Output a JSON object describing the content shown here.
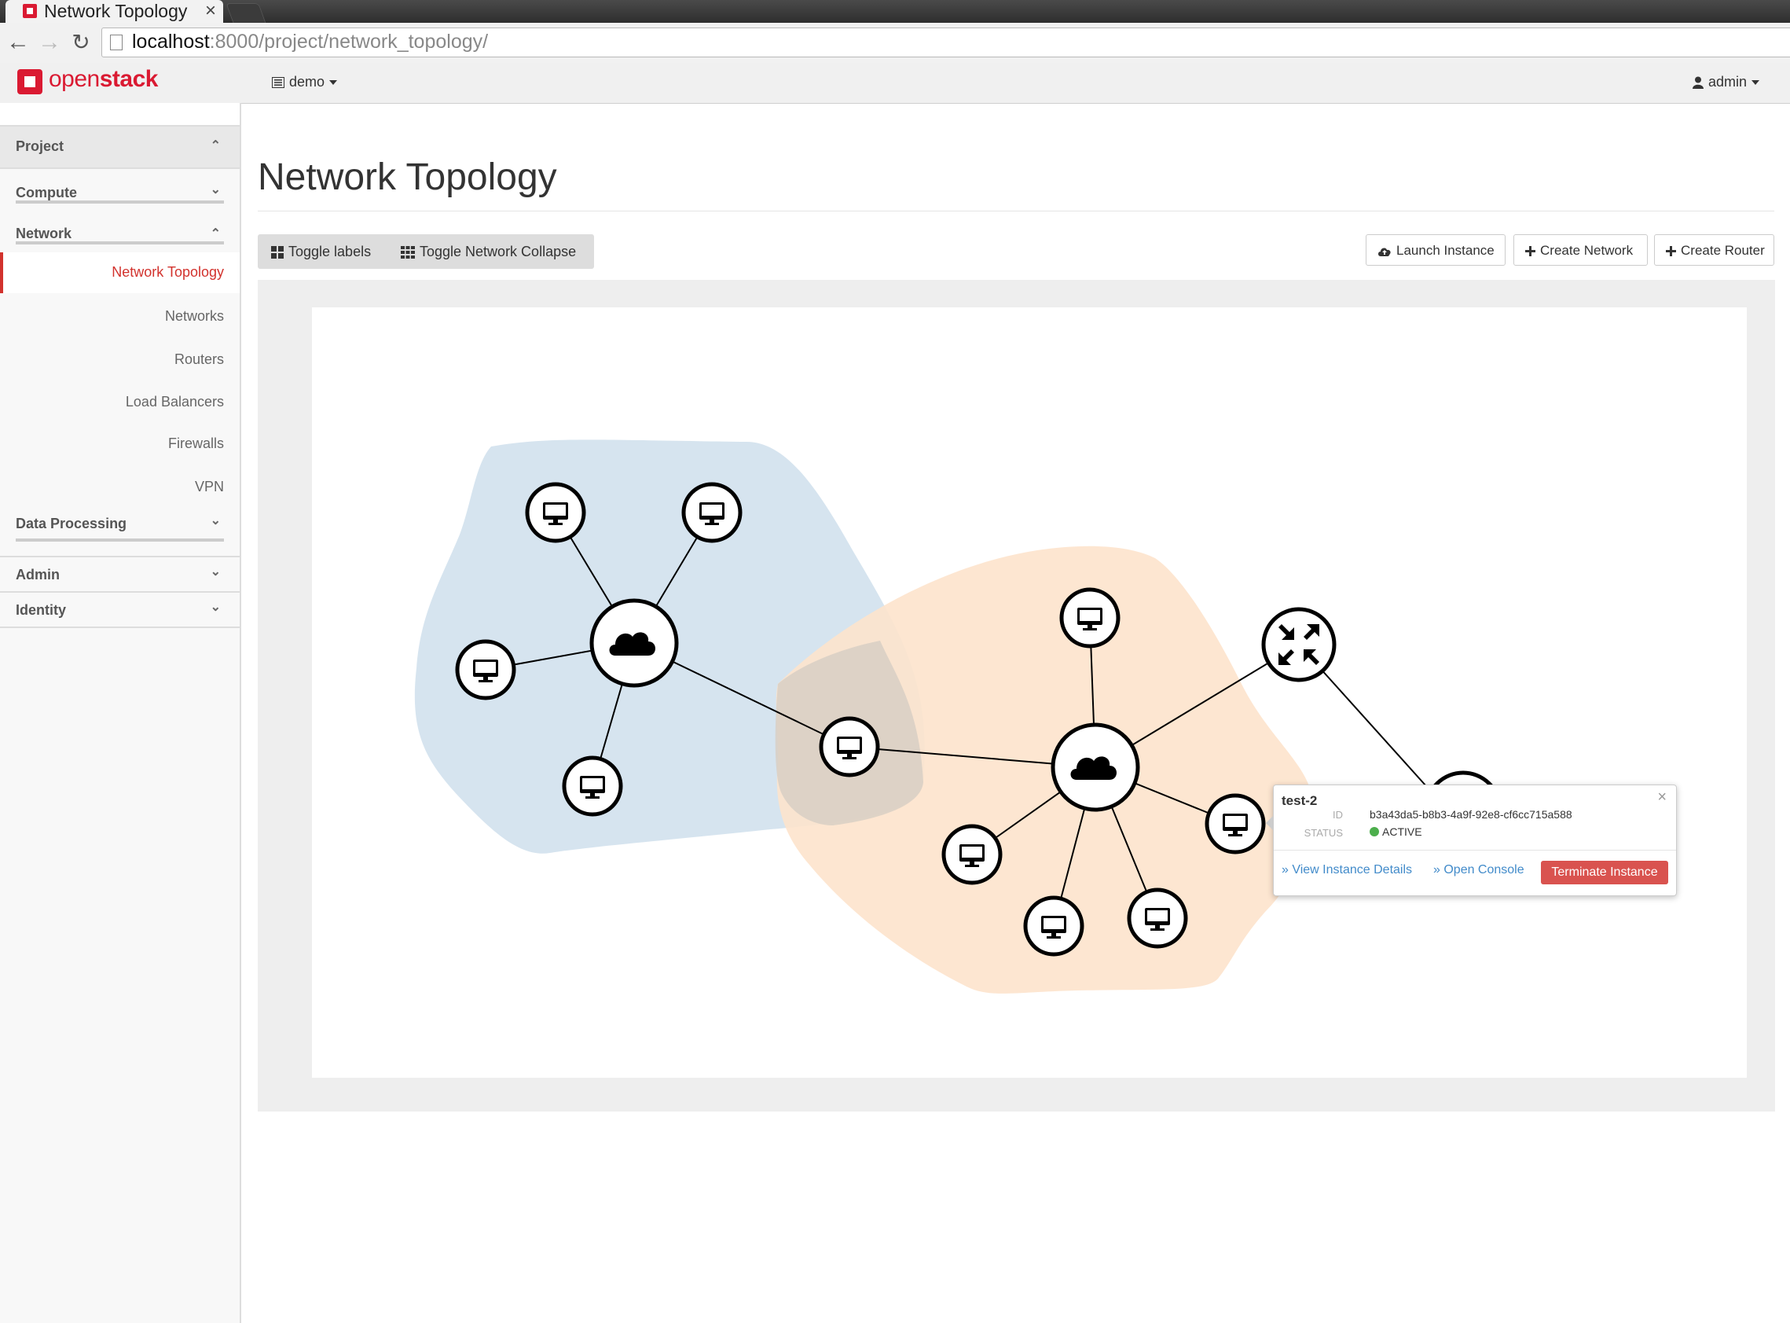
{
  "browser": {
    "tab_title": "Network Topology",
    "tab_close": "×",
    "url_host": "localhost",
    "url_rest": ":8000/project/network_topology/"
  },
  "header": {
    "logo_open": "open",
    "logo_stack": "stack",
    "project": "demo",
    "user": "admin"
  },
  "sidebar": {
    "project": "Project",
    "compute": "Compute",
    "network": "Network",
    "items": [
      "Network Topology",
      "Networks",
      "Routers",
      "Load Balancers",
      "Firewalls",
      "VPN"
    ],
    "data_processing": "Data Processing",
    "admin": "Admin",
    "identity": "Identity"
  },
  "main": {
    "title": "Network Topology",
    "toggle_labels": "Toggle labels",
    "toggle_collapse": "Toggle Network Collapse",
    "launch_instance": "Launch Instance",
    "create_network": "Create Network",
    "create_router": "Create Router"
  },
  "colors": {
    "accent": "#d2322d",
    "network_blue": "#d2e2ee",
    "network_orange": "#fde3cc",
    "status_active": "#4cae4c"
  },
  "popup": {
    "name": "test-2",
    "id_label": "ID",
    "id_value": "b3a43da5-b8b3-4a9f-92e8-cf6cc715a588",
    "status_label": "STATUS",
    "status_value": "ACTIVE",
    "view_details": "» View Instance Details",
    "open_console": "» Open Console",
    "terminate": "Terminate Instance",
    "close": "×"
  }
}
